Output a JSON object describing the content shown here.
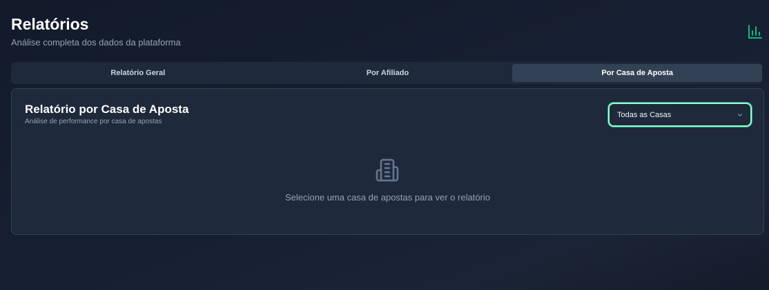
{
  "header": {
    "title": "Relatórios",
    "subtitle": "Análise completa dos dados da plataforma",
    "icon": "bar-chart-icon",
    "accent_color": "#10b981"
  },
  "tabs": [
    {
      "label": "Relatório Geral",
      "active": false
    },
    {
      "label": "Por Afiliado",
      "active": false
    },
    {
      "label": "Por Casa de Aposta",
      "active": true
    }
  ],
  "card": {
    "title": "Relatório por Casa de Aposta",
    "subtitle": "Análise de performance por casa de apostas",
    "select": {
      "value": "Todas as Casas",
      "icon": "chevron-down-icon"
    },
    "empty_state": {
      "icon": "building-icon",
      "message": "Selecione uma casa de apostas para ver o relatório"
    }
  }
}
